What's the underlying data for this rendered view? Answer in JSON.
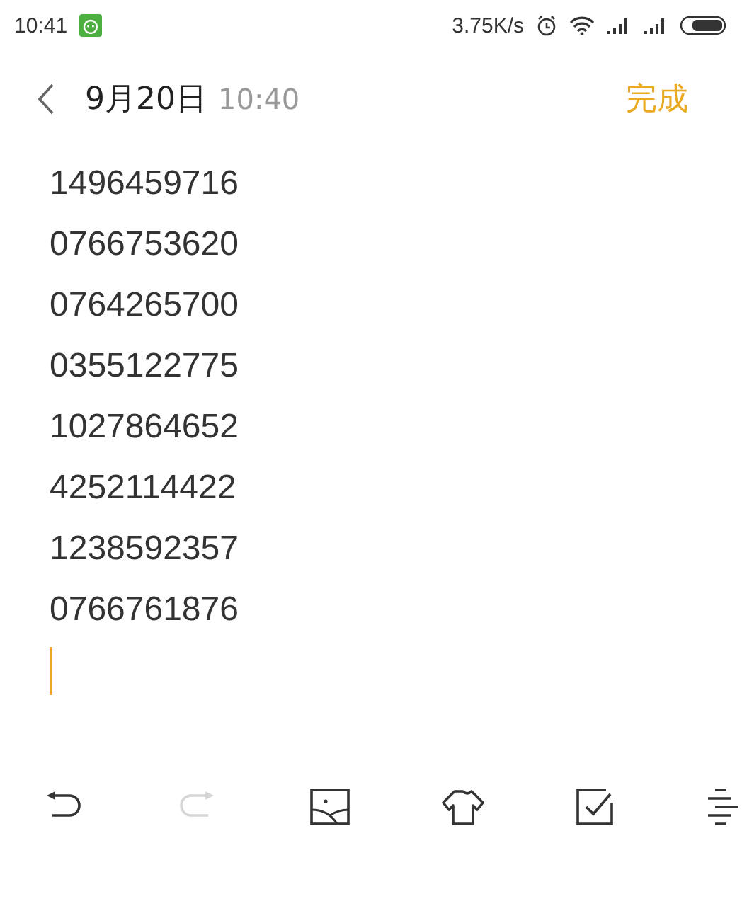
{
  "status_bar": {
    "time": "10:41",
    "speed": "3.75K/s"
  },
  "header": {
    "date": "9月20日",
    "time": "10:40",
    "done": "完成"
  },
  "note": {
    "lines": [
      "1496459716",
      "0766753620",
      "0764265700",
      "0355122775",
      "1027864652",
      "4252114422",
      "1238592357",
      "0766761876"
    ],
    "cursor": true
  },
  "toolbar": [
    {
      "kind": "undo",
      "disabled": false
    },
    {
      "kind": "redo",
      "disabled": true
    },
    {
      "kind": "image",
      "disabled": false
    },
    {
      "kind": "shirt",
      "disabled": false
    },
    {
      "kind": "checkbox",
      "disabled": false
    },
    {
      "kind": "list",
      "disabled": false
    }
  ]
}
